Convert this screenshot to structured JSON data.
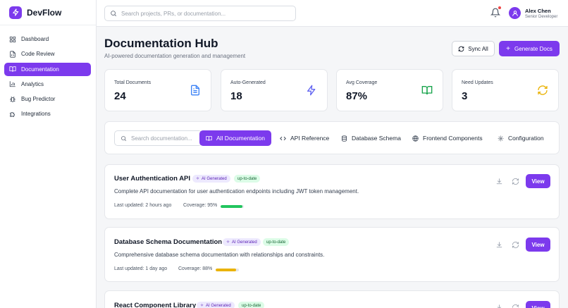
{
  "app": {
    "name": "DevFlow"
  },
  "sidebar": {
    "items": [
      {
        "label": "Dashboard",
        "icon": "grid-icon"
      },
      {
        "label": "Code Review",
        "icon": "file-code-icon"
      },
      {
        "label": "Documentation",
        "icon": "book-open-icon",
        "active": true
      },
      {
        "label": "Analytics",
        "icon": "bar-chart-icon"
      },
      {
        "label": "Bug Predictor",
        "icon": "bug-icon"
      },
      {
        "label": "Integrations",
        "icon": "puzzle-icon"
      }
    ]
  },
  "topbar": {
    "search_placeholder": "Search projects, PRs, or documentation...",
    "user": {
      "name": "Alex Chen",
      "role": "Senior Developer"
    }
  },
  "header": {
    "title": "Documentation Hub",
    "subtitle": "AI-powered documentation generation and management",
    "sync_label": "Sync All",
    "generate_label": "Generate Docs"
  },
  "stats": [
    {
      "label": "Total Documents",
      "value": "24",
      "icon": "file-text-icon",
      "color": "#3b82f6"
    },
    {
      "label": "Auto-Generated",
      "value": "18",
      "icon": "zap-icon",
      "color": "#6366f1"
    },
    {
      "label": "Avg Coverage",
      "value": "87%",
      "icon": "book-open-icon",
      "color": "#16a34a"
    },
    {
      "label": "Need Updates",
      "value": "3",
      "icon": "refresh-icon",
      "color": "#eab308"
    }
  ],
  "filters": {
    "search_placeholder": "Search documentation...",
    "tabs": [
      {
        "label": "All Documentation",
        "icon": "book-open-icon",
        "active": true
      },
      {
        "label": "API Reference",
        "icon": "code-icon"
      },
      {
        "label": "Database Schema",
        "icon": "database-icon"
      },
      {
        "label": "Frontend Components",
        "icon": "globe-icon"
      },
      {
        "label": "Configuration",
        "icon": "settings-icon"
      }
    ]
  },
  "docs": [
    {
      "title": "User Authentication API",
      "ai_badge": "AI Generated",
      "status": "up-to-date",
      "description": "Complete API documentation for user authentication endpoints including JWT token management.",
      "updated": "Last updated: 2 hours ago",
      "coverage_label": "Coverage: 95%",
      "coverage": 0.95,
      "coverage_color": "#22c55e",
      "view_label": "View"
    },
    {
      "title": "Database Schema Documentation",
      "ai_badge": "AI Generated",
      "status": "up-to-date",
      "description": "Comprehensive database schema documentation with relationships and constraints.",
      "updated": "Last updated: 1 day ago",
      "coverage_label": "Coverage: 88%",
      "coverage": 0.88,
      "coverage_color": "#eab308",
      "view_label": "View"
    },
    {
      "title": "React Component Library",
      "ai_badge": "AI Generated",
      "status": "up-to-date",
      "view_label": "View"
    }
  ],
  "colors": {
    "accent": "#7c3aed",
    "success": "#22c55e",
    "warning": "#eab308"
  }
}
